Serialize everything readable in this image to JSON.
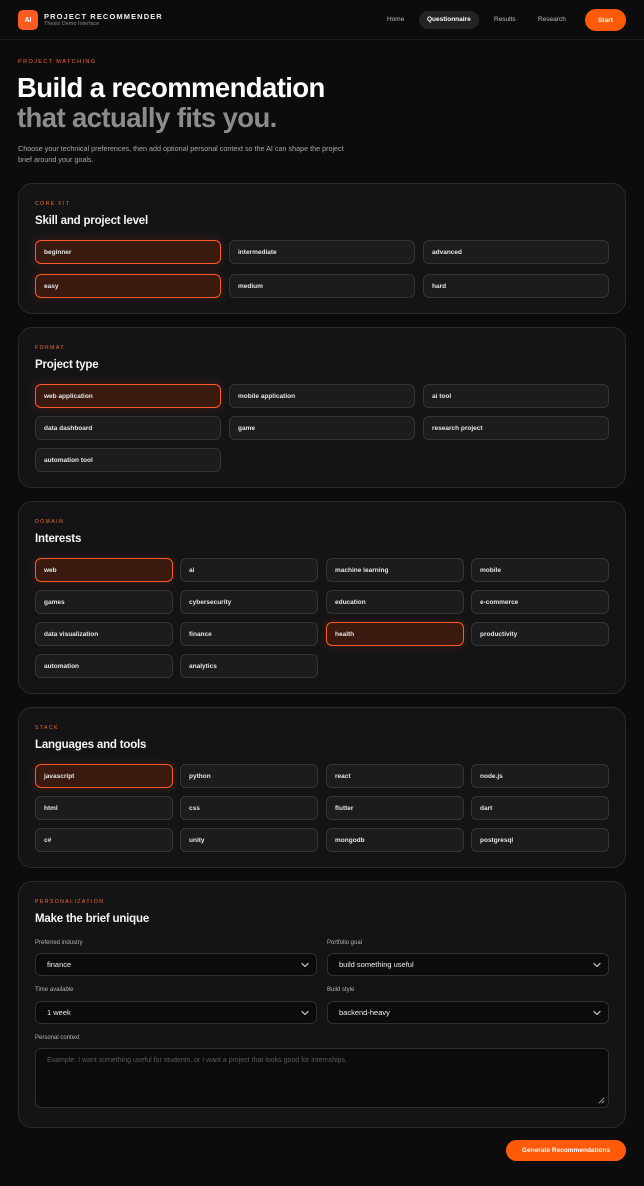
{
  "header": {
    "logo_text": "AI",
    "brand_title": "PROJECT RECOMMENDER",
    "brand_subtitle": "Thesis Demo Interface",
    "nav": [
      "Home",
      "Questionnaire",
      "Results",
      "Research"
    ],
    "active_nav": "Questionnaire",
    "start_label": "Start"
  },
  "hero": {
    "eyebrow": "PROJECT MATCHING",
    "title_line1": "Build a recommendation",
    "title_line2": "that actually fits you.",
    "intro": "Choose your technical preferences, then add optional personal context so the AI can shape the project brief around your goals."
  },
  "core_fit": {
    "eyebrow": "CORE FIT",
    "title": "Skill and project level",
    "skill_levels": [
      "beginner",
      "intermediate",
      "advanced"
    ],
    "difficulty_levels": [
      "easy",
      "medium",
      "hard"
    ],
    "selected": [
      "beginner",
      "easy"
    ]
  },
  "format": {
    "eyebrow": "FORMAT",
    "title": "Project type",
    "options": [
      "web application",
      "mobile application",
      "ai tool",
      "data dashboard",
      "game",
      "research project",
      "automation tool"
    ],
    "selected": [
      "web application"
    ]
  },
  "domain": {
    "eyebrow": "DOMAIN",
    "title": "Interests",
    "options": [
      "web",
      "ai",
      "machine learning",
      "mobile",
      "games",
      "cybersecurity",
      "education",
      "e-commerce",
      "data visualization",
      "finance",
      "health",
      "productivity",
      "automation",
      "analytics"
    ],
    "selected": [
      "web",
      "health"
    ]
  },
  "stack": {
    "eyebrow": "STACK",
    "title": "Languages and tools",
    "options": [
      "javascript",
      "python",
      "react",
      "node.js",
      "html",
      "css",
      "flutter",
      "dart",
      "c#",
      "unity",
      "mongodb",
      "postgresql"
    ],
    "selected": [
      "javascript"
    ]
  },
  "personalization": {
    "eyebrow": "PERSONALIZATION",
    "title": "Make the brief unique",
    "industry_label": "Preferred industry",
    "industry_value": "finance",
    "goal_label": "Portfolio goal",
    "goal_value": "build something useful",
    "time_label": "Time available",
    "time_value": "1 week",
    "style_label": "Build style",
    "style_value": "backend-heavy",
    "context_label": "Personal context",
    "context_placeholder": "Example: I want something useful for students, or I want a project that looks good for internships."
  },
  "generate_label": "Generate Recommendations",
  "colors": {
    "accent": "#ff5a1f",
    "background": "#0c0c0d",
    "card": "#141416",
    "chip": "#1c1c1e",
    "chip_selected": "#3a1a0e"
  }
}
